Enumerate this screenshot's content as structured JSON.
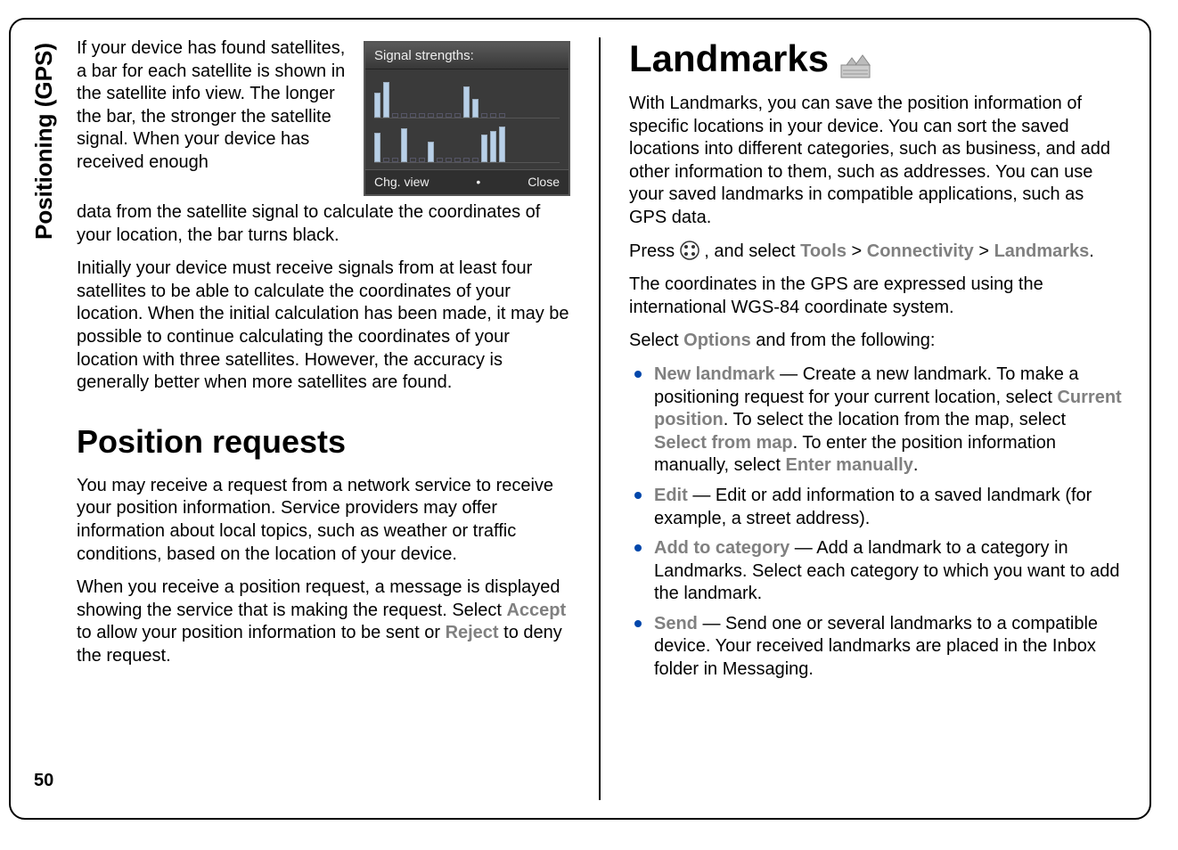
{
  "side_label": "Positioning (GPS)",
  "page_number": "50",
  "left": {
    "para1a": "If your device has found satellites, a bar for each satellite is shown in the satellite info view. The longer the bar, the stronger the satellite signal. When your device has received enough",
    "para1b": "data from the satellite signal to calculate the coordinates of your location, the bar turns black.",
    "para2": "Initially your device must receive signals from at least four satellites to be able to calculate the coordinates of your location. When the initial calculation has been made, it may be possible to continue calculating the coordinates of your location with three satellites. However, the accuracy is generally better when more satellites are found.",
    "h2": "Position requests",
    "para3": "You may receive a request from a network service to receive your position information. Service providers may offer information about local topics, such as weather or traffic conditions, based on the location of your device.",
    "para4_a": "When you receive a position request, a message is displayed showing the service that is making the request. Select ",
    "accept": "Accept",
    "para4_b": " to allow your position information to be sent or ",
    "reject": "Reject",
    "para4_c": " to deny the request."
  },
  "figure": {
    "title": "Signal strengths:",
    "sk_left": "Chg. view",
    "sk_right": "Close"
  },
  "right": {
    "h1": "Landmarks",
    "para1": "With Landmarks, you can save the position information of specific locations in your device. You can sort the saved locations into different categories, such as business, and add other information to them, such as addresses. You can use your saved landmarks in compatible applications, such as GPS data.",
    "press_a": "Press ",
    "press_b": " , and select ",
    "tools": "Tools",
    "gt1": " > ",
    "connectivity": "Connectivity",
    "gt2": " > ",
    "landmarks": "Landmarks",
    "period": ".",
    "para2": "The coordinates in the GPS are expressed using the international WGS-84 coordinate system.",
    "sel_a": "Select ",
    "options": "Options",
    "sel_b": " and from the following:",
    "items": {
      "i1": {
        "lead": "New landmark",
        "t1": " — Create a new landmark. To make a positioning request for your current location, select ",
        "curpos": "Current position",
        "t2": ". To select the location from the map, select ",
        "selmap": "Select from map",
        "t3": ". To enter the position information manually, select ",
        "entman": "Enter manually",
        "t4": "."
      },
      "i2": {
        "lead": "Edit",
        "t1": " — Edit or add information to a saved landmark (for example, a street address)."
      },
      "i3": {
        "lead": "Add to category",
        "t1": " — Add a landmark to a category in Landmarks. Select each category to which you want to add the landmark."
      },
      "i4": {
        "lead": "Send",
        "t1": " — Send one or several landmarks to a compatible device. Your received landmarks are placed in the Inbox folder in Messaging."
      }
    }
  }
}
